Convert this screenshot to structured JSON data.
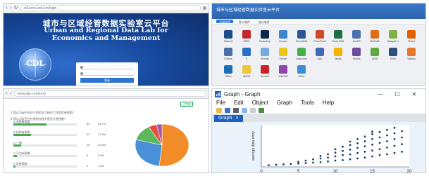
{
  "login_panel": {
    "url": "cdl.ecnu.edu.cn/login",
    "title_cn": "城市与区域经管数据实验室云平台",
    "title_en_lines": [
      "Urban and Regional Data Lab for",
      "Economics and Management"
    ],
    "logo_text": "CDL",
    "login_button": "登录"
  },
  "apps_panel": {
    "header_title": "城市与区域经管数据实验室云平台",
    "tabs": [
      {
        "label": "全部应用",
        "active": true
      },
      {
        "label": "办公软件",
        "active": false
      },
      {
        "label": "统计软件",
        "active": false
      }
    ],
    "apps": [
      {
        "label": "Stata 16",
        "color": "#1a4f8c"
      },
      {
        "label": "SPSS",
        "color": "#c2272d"
      },
      {
        "label": "Photoshop",
        "color": "#0d2a4a"
      },
      {
        "label": "Chrome",
        "color": "#3a86d1"
      },
      {
        "label": "Word 2016",
        "color": "#2b5797"
      },
      {
        "label": "PowerPoint",
        "color": "#d24726"
      },
      {
        "label": "Excel 2016",
        "color": "#1d7044"
      },
      {
        "label": "ArcGIS",
        "color": "#4a72b0"
      },
      {
        "label": "MATLAB",
        "color": "#e06c1a"
      },
      {
        "label": "Notepad++",
        "color": "#7cb342"
      },
      {
        "label": "Firefox",
        "color": "#e66000"
      },
      {
        "label": "EViews",
        "color": "#4b6fa8"
      },
      {
        "label": "R",
        "color": "#2770c6"
      },
      {
        "label": "RStudio",
        "color": "#75aadb"
      },
      {
        "label": "Python",
        "color": "#f0c419"
      },
      {
        "label": "Anaconda",
        "color": "#43b049"
      },
      {
        "label": "SAS",
        "color": "#3e6bb4"
      },
      {
        "label": "Mplus",
        "color": "#f4b400"
      },
      {
        "label": "GeoDa",
        "color": "#6d4c9e"
      },
      {
        "label": "QGIS",
        "color": "#5fa840"
      },
      {
        "label": "ENVI",
        "color": "#2f4f7f"
      },
      {
        "label": "Tableau",
        "color": "#e8762d"
      },
      {
        "label": "NVivo",
        "color": "#1c6fb5"
      },
      {
        "label": "AMOS",
        "color": "#f2c43d"
      },
      {
        "label": "Acrobat",
        "color": "#cc2127"
      },
      {
        "label": "WinRAR",
        "color": "#8e44ad"
      },
      {
        "label": "Office",
        "color": "#3c8dd9"
      }
    ]
  },
  "survey_panel": {
    "url": "www.wjx.cn/report",
    "question_1": "1.您认为云平台对于您的学习研究工作是否有帮助？",
    "question_2": "2.您认为云平台在使用过程中是否方便快捷？",
    "badge": "已完成",
    "options": [
      {
        "label": "A.非常有帮助",
        "count": "62",
        "percent": "51.7%",
        "fraction": 0.517
      },
      {
        "label": "B.比较有帮助",
        "count": "33",
        "percent": "27.5%",
        "fraction": 0.275
      },
      {
        "label": "C.一般",
        "count": "15",
        "percent": "12.5%",
        "fraction": 0.125
      },
      {
        "label": "D.不太有帮助",
        "count": "6",
        "percent": "5.0%",
        "fraction": 0.05
      },
      {
        "label": "E.没有帮助",
        "count": "4",
        "percent": "3.3%",
        "fraction": 0.033
      }
    ],
    "pie_colors": [
      "#f28c28",
      "#4a90d9",
      "#5cb85c",
      "#e74c3c",
      "#9b59b6"
    ]
  },
  "graph_panel": {
    "window_title": "Graph - Graph",
    "menu": [
      "File",
      "Edit",
      "Object",
      "Graph",
      "Tools",
      "Help"
    ],
    "tab_label": "Graph",
    "tab_close": "×",
    "ylabel": "average data entry",
    "minimize": "—",
    "maximize": "☐",
    "close": "✕",
    "chart_data": {
      "type": "scatter",
      "x_ticks": [
        "0",
        "5",
        "10",
        "15",
        "20"
      ],
      "xlim": [
        0,
        20
      ],
      "ylim": [
        0,
        10
      ],
      "points": [
        [
          1,
          0.4
        ],
        [
          2,
          0.5
        ],
        [
          3,
          0.6
        ],
        [
          4,
          0.7
        ],
        [
          5,
          0.8
        ],
        [
          5,
          1.2
        ],
        [
          6,
          0.9
        ],
        [
          6,
          1.5
        ],
        [
          7,
          1.0
        ],
        [
          7,
          1.8
        ],
        [
          8,
          1.1
        ],
        [
          8,
          2.0
        ],
        [
          8,
          2.6
        ],
        [
          9,
          1.3
        ],
        [
          9,
          2.2
        ],
        [
          9,
          3.0
        ],
        [
          10,
          1.5
        ],
        [
          10,
          2.5
        ],
        [
          10,
          3.4
        ],
        [
          10,
          4.2
        ],
        [
          11,
          1.6
        ],
        [
          11,
          2.8
        ],
        [
          11,
          3.8
        ],
        [
          11,
          4.8
        ],
        [
          12,
          1.8
        ],
        [
          12,
          3.0
        ],
        [
          12,
          4.1
        ],
        [
          12,
          5.2
        ],
        [
          12,
          6.0
        ],
        [
          13,
          2.0
        ],
        [
          13,
          3.3
        ],
        [
          13,
          4.5
        ],
        [
          13,
          5.6
        ],
        [
          13,
          6.6
        ],
        [
          14,
          2.2
        ],
        [
          14,
          3.6
        ],
        [
          14,
          4.9
        ],
        [
          14,
          6.1
        ],
        [
          14,
          7.2
        ],
        [
          15,
          2.5
        ],
        [
          15,
          3.9
        ],
        [
          15,
          5.3
        ],
        [
          15,
          6.6
        ],
        [
          15,
          7.8
        ],
        [
          15,
          8.4
        ],
        [
          16,
          2.8
        ],
        [
          16,
          4.2
        ],
        [
          16,
          5.7
        ],
        [
          16,
          7.0
        ],
        [
          16,
          8.3
        ],
        [
          17,
          3.0
        ],
        [
          17,
          4.6
        ],
        [
          17,
          6.1
        ],
        [
          17,
          7.5
        ],
        [
          17,
          8.8
        ],
        [
          18,
          3.3
        ],
        [
          18,
          5.0
        ],
        [
          18,
          6.6
        ],
        [
          18,
          8.0
        ],
        [
          18,
          9.3
        ],
        [
          19,
          3.6
        ],
        [
          19,
          5.4
        ],
        [
          19,
          7.0
        ],
        [
          19,
          8.5
        ]
      ]
    }
  }
}
